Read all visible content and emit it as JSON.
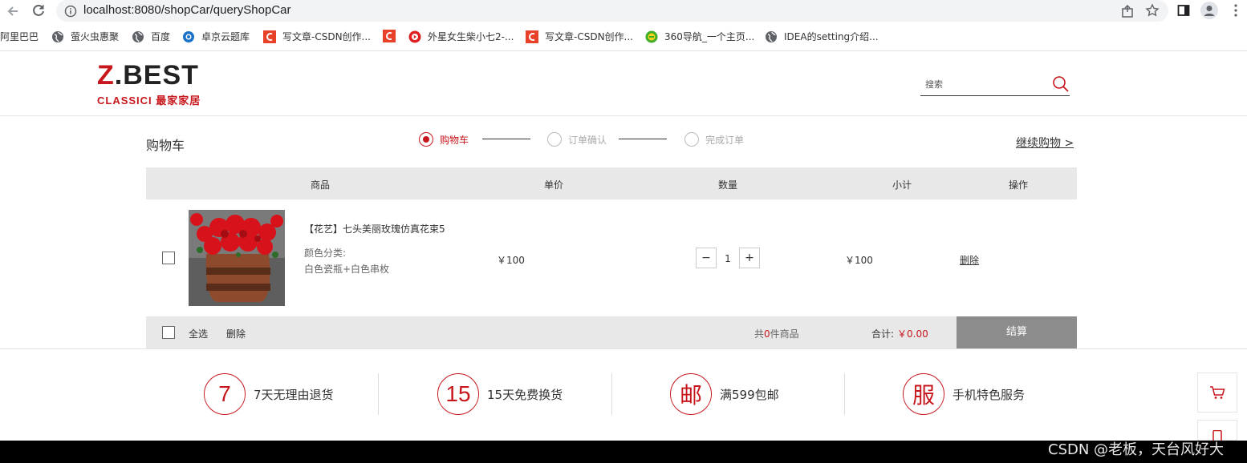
{
  "browser": {
    "url": "localhost:8080/shopCar/queryShopCar",
    "bookmarks": [
      {
        "label": "阿里巴巴",
        "icon": "none"
      },
      {
        "label": "萤火虫惠聚",
        "icon": "globe-icon"
      },
      {
        "label": "百度",
        "icon": "globe-icon"
      },
      {
        "label": "卓京云题库",
        "icon": "ie-icon"
      },
      {
        "label": "写文章-CSDN创作...",
        "icon": "csdn-icon"
      },
      {
        "label": "",
        "icon": "csdn-icon"
      },
      {
        "label": "外星女生柴小七2-...",
        "icon": "video-icon"
      },
      {
        "label": "写文章-CSDN创作...",
        "icon": "csdn-icon"
      },
      {
        "label": "360导航_一个主页...",
        "icon": "360-icon"
      },
      {
        "label": "IDEA的setting介绍...",
        "icon": "globe-icon"
      }
    ]
  },
  "header": {
    "logo_main_a": "Z",
    "logo_main_b": ".BEST",
    "logo_sub": "CLASSICI 最家家居",
    "search_placeholder": "搜索"
  },
  "cart": {
    "title": "购物车",
    "steps": [
      "购物车",
      "订单确认",
      "完成订单"
    ],
    "continue_label": "继续购物 >",
    "columns": [
      "商品",
      "单价",
      "数量",
      "小计",
      "操作"
    ],
    "items": [
      {
        "name": "【花艺】七头美丽玫瑰仿真花束5",
        "spec_label": "颜色分类:",
        "spec_value": "白色瓷瓶+白色串枚",
        "price": "￥100",
        "qty": "1",
        "subtotal": "￥100",
        "delete_label": "删除"
      }
    ],
    "footer": {
      "select_all_label": "全选",
      "delete_label": "删除",
      "count_prefix": "共",
      "count": "0",
      "count_suffix": "件商品",
      "total_label": "合计:",
      "total_value": "￥0.00",
      "checkout_label": "结算"
    }
  },
  "services": [
    {
      "icon_text": "7",
      "label": "7天无理由退货"
    },
    {
      "icon_text": "15",
      "label": "15天免费换货"
    },
    {
      "icon_text": "邮",
      "label": "满599包邮"
    },
    {
      "icon_text": "服",
      "label": "手机特色服务"
    }
  ],
  "watermark": "CSDN @老板，天台风好大",
  "colors": {
    "accent": "#c8161d",
    "checkout_bg": "#8c8c8c",
    "table_header_bg": "#e8e8e8"
  }
}
